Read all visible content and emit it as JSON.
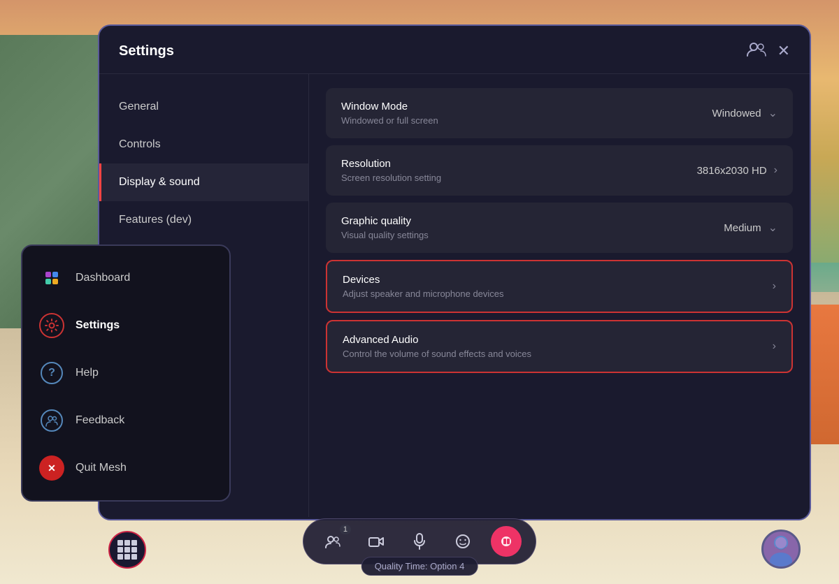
{
  "app": {
    "title": "Quality Time: Option 4"
  },
  "settings": {
    "title": "Settings",
    "sidebar": {
      "items": [
        {
          "id": "general",
          "label": "General",
          "active": false
        },
        {
          "id": "controls",
          "label": "Controls",
          "active": false
        },
        {
          "id": "display-sound",
          "label": "Display & sound",
          "active": true
        },
        {
          "id": "features-dev",
          "label": "Features (dev)",
          "active": false
        }
      ]
    },
    "content": {
      "rows": [
        {
          "id": "window-mode",
          "name": "Window Mode",
          "desc": "Windowed or full screen",
          "value": "Windowed",
          "type": "dropdown",
          "bordered": false
        },
        {
          "id": "resolution",
          "name": "Resolution",
          "desc": "Screen resolution setting",
          "value": "3816x2030 HD",
          "type": "arrow",
          "bordered": false
        },
        {
          "id": "graphic-quality",
          "name": "Graphic quality",
          "desc": "Visual quality settings",
          "value": "Medium",
          "type": "dropdown",
          "bordered": false
        },
        {
          "id": "devices",
          "name": "Devices",
          "desc": "Adjust speaker and microphone devices",
          "value": "",
          "type": "arrow",
          "bordered": true
        },
        {
          "id": "advanced-audio",
          "name": "Advanced Audio",
          "desc": "Control the volume of sound effects and voices",
          "value": "",
          "type": "arrow",
          "bordered": true
        }
      ]
    }
  },
  "overlay_menu": {
    "items": [
      {
        "id": "dashboard",
        "label": "Dashboard",
        "icon_type": "dashboard"
      },
      {
        "id": "settings",
        "label": "Settings",
        "icon_type": "settings",
        "active": true
      },
      {
        "id": "help",
        "label": "Help",
        "icon_type": "help"
      },
      {
        "id": "feedback",
        "label": "Feedback",
        "icon_type": "feedback"
      },
      {
        "id": "quit",
        "label": "Quit Mesh",
        "icon_type": "quit"
      }
    ]
  },
  "taskbar": {
    "people_count": "1",
    "buttons": [
      {
        "id": "people",
        "icon": "👤",
        "label": "People"
      },
      {
        "id": "camera",
        "icon": "📷",
        "label": "Camera"
      },
      {
        "id": "microphone",
        "icon": "🎤",
        "label": "Microphone"
      },
      {
        "id": "emoji",
        "icon": "😊",
        "label": "Emoji"
      },
      {
        "id": "record",
        "icon": "⏺",
        "label": "Record",
        "active": true
      }
    ],
    "grid_label": "Apps",
    "quality_label": "Quality Time: Option 4"
  }
}
